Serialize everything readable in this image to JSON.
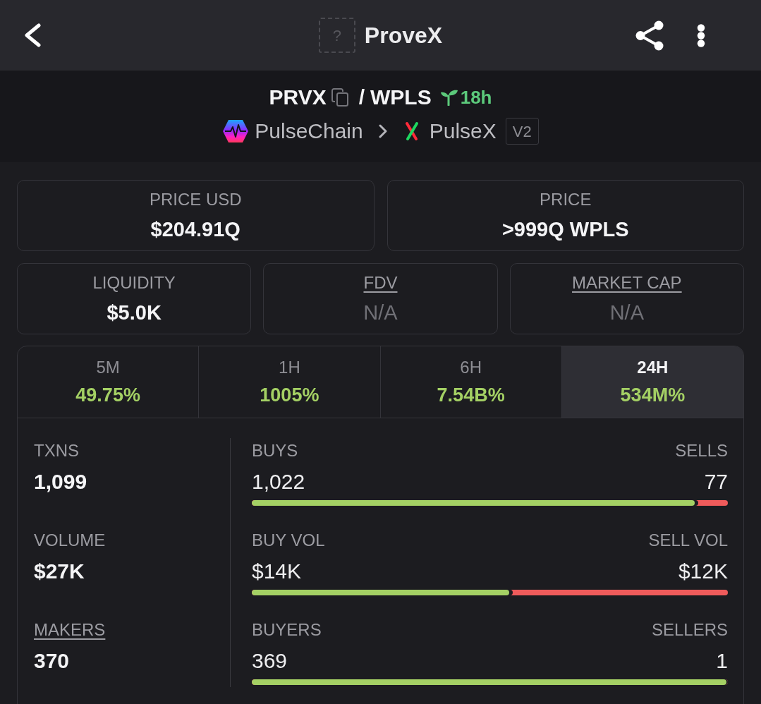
{
  "header": {
    "icon_glyph": "?",
    "title": "ProveX"
  },
  "pair": {
    "base": "PRVX",
    "separator": "/",
    "quote": "WPLS",
    "age": "18h",
    "chain": "PulseChain",
    "dex": "PulseX",
    "version": "V2"
  },
  "price_cards": [
    {
      "label": "PRICE USD",
      "value": "$204.91Q",
      "underlined": false,
      "muted": false
    },
    {
      "label": "PRICE",
      "value": ">999Q WPLS",
      "underlined": false,
      "muted": false
    }
  ],
  "market_cards": [
    {
      "label": "LIQUIDITY",
      "value": "$5.0K",
      "underlined": false,
      "muted": false
    },
    {
      "label": "FDV",
      "value": "N/A",
      "underlined": true,
      "muted": true
    },
    {
      "label": "MARKET CAP",
      "value": "N/A",
      "underlined": true,
      "muted": true
    }
  ],
  "timeframes": [
    {
      "label": "5M",
      "change": "49.75%",
      "selected": false
    },
    {
      "label": "1H",
      "change": "1005%",
      "selected": false
    },
    {
      "label": "6H",
      "change": "7.54B%",
      "selected": false
    },
    {
      "label": "24H",
      "change": "534M%",
      "selected": true
    }
  ],
  "stats": [
    {
      "label": "TXNS",
      "value": "1,099",
      "underlined": false
    },
    {
      "label": "VOLUME",
      "value": "$27K",
      "underlined": false
    },
    {
      "label": "MAKERS",
      "value": "370",
      "underlined": true
    }
  ],
  "ratios": [
    {
      "buy_label": "BUYS",
      "buy_value": "1,022",
      "sell_label": "SELLS",
      "sell_value": "77",
      "level": 0.93
    },
    {
      "buy_label": "BUY VOL",
      "buy_value": "$14K",
      "sell_label": "SELL VOL",
      "sell_value": "$12K",
      "level": 0.54
    },
    {
      "buy_label": "BUYERS",
      "buy_value": "369",
      "sell_label": "SELLERS",
      "sell_value": "1",
      "level": 0.997
    }
  ]
}
